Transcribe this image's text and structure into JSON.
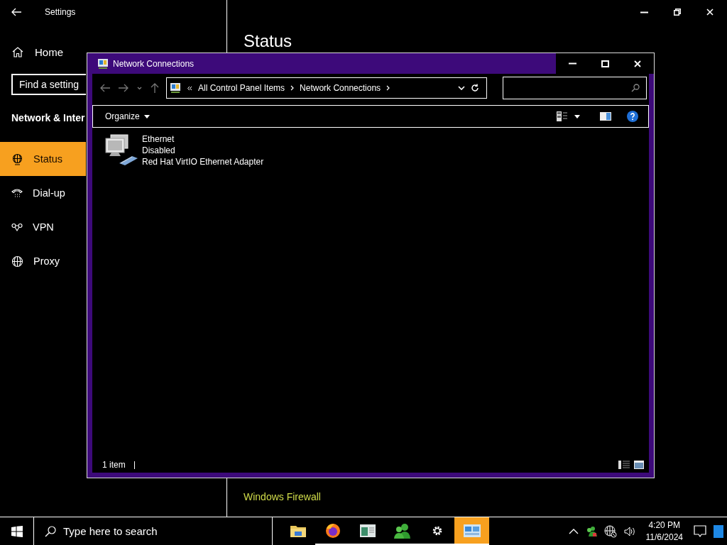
{
  "settings": {
    "title": "Settings",
    "home": "Home",
    "search": {
      "placeholder": "Find a setting"
    },
    "section": "Network & Inter",
    "items": [
      {
        "label": "Status",
        "kind": "status",
        "selected": true
      },
      {
        "label": "Dial-up",
        "kind": "dialup",
        "selected": false
      },
      {
        "label": "VPN",
        "kind": "vpn",
        "selected": false
      },
      {
        "label": "Proxy",
        "kind": "proxy",
        "selected": false
      }
    ],
    "heading": "Status",
    "link": "Windows Firewall"
  },
  "explorer": {
    "title": "Network Connections",
    "breadcrumb": [
      "All Control Panel Items",
      "Network Connections"
    ],
    "organize": "Organize",
    "items": [
      {
        "name": "Ethernet",
        "status": "Disabled",
        "device": "Red Hat VirtIO Ethernet Adapter"
      }
    ],
    "status_bar": "1 item"
  },
  "taskbar": {
    "search": {
      "placeholder": "Type here to search"
    },
    "apps": [
      {
        "kind": "folder",
        "running": false,
        "selected": false
      },
      {
        "kind": "firefox",
        "running": true,
        "selected": false
      },
      {
        "kind": "window",
        "running": true,
        "selected": false
      },
      {
        "kind": "people",
        "running": true,
        "selected": false
      },
      {
        "kind": "gear",
        "running": true,
        "selected": false
      },
      {
        "kind": "network",
        "running": true,
        "selected": true
      }
    ],
    "clock": {
      "time": "4:20 PM",
      "date": "11/6/2024"
    }
  }
}
